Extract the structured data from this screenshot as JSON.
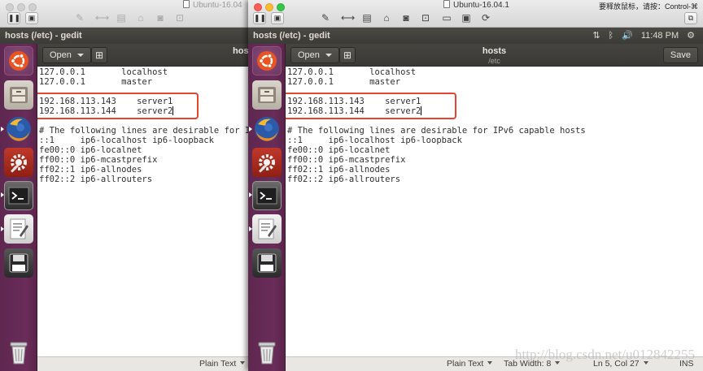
{
  "left_window": {
    "vm_title": "Ubuntu-16.04",
    "panel_title": "hosts (/etc) - gedit",
    "header": {
      "open_label": "Open",
      "title": "hos"
    },
    "lines": [
      "127.0.0.1       localhost",
      "127.0.0.1       master",
      "",
      "192.168.113.143    server1",
      "192.168.113.144    server2",
      "",
      "# The following lines are desirable for I",
      "::1     ip6-localhost ip6-loopback",
      "fe00::0 ip6-localnet",
      "ff00::0 ip6-mcastprefix",
      "ff02::1 ip6-allnodes",
      "ff02::2 ip6-allrouters"
    ],
    "status": {
      "language": "Plain Text"
    }
  },
  "right_window": {
    "vm_title": "Ubuntu-16.04.1",
    "vm_hint": "要释放鼠标，请按：Control-⌘",
    "panel_title": "hosts (/etc) - gedit",
    "indicators": {
      "network": "⇅",
      "bluetooth": "ᛒ",
      "volume": "🔊",
      "clock": "11:48 PM",
      "gear": "⚙"
    },
    "header": {
      "open_label": "Open",
      "title": "hosts",
      "subtitle": "/etc",
      "save_label": "Save"
    },
    "lines": [
      "127.0.0.1       localhost",
      "127.0.0.1       master",
      "",
      "192.168.113.143    server1",
      "192.168.113.144    server2",
      "",
      "# The following lines are desirable for IPv6 capable hosts",
      "::1     ip6-localhost ip6-loopback",
      "fe00::0 ip6-localnet",
      "ff00::0 ip6-mcastprefix",
      "ff02::1 ip6-allnodes",
      "ff02::2 ip6-allrouters"
    ],
    "status": {
      "language": "Plain Text",
      "tab_width": "Tab Width: 8",
      "position": "Ln 5, Col 27",
      "mode": "INS"
    }
  },
  "watermark": "http://blog.csdn.net/u012842255",
  "colors": {
    "launcher": "#5e2750",
    "highlight_box": "#e8432d",
    "panel": "#3c3b37"
  }
}
